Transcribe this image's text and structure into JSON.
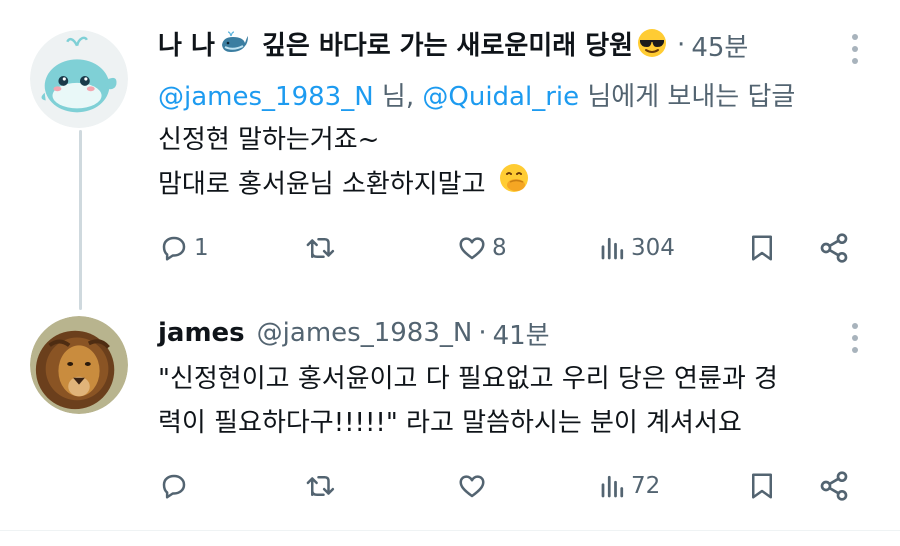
{
  "tweets": [
    {
      "display_name": "나 나🐋 깊은 바다로 가는 새로운미래 당원😎",
      "display_name_parts": {
        "before_whale": "나 나",
        "after_whale": " 깊은 바다로 가는 새로운미래 당원"
      },
      "handle": "",
      "sep": "·",
      "time": "45분",
      "reply_to": {
        "mention1": "@james_1983_N",
        "suffix1": " 님, ",
        "mention2": "@Quidal_rie",
        "suffix2": " 님에게 보내는 답글"
      },
      "text_lines": [
        "신정현 말하는거죠~",
        "맘대로 홍서윤님 소환하지말고 🤭"
      ],
      "text_line2_main": "맘대로 홍서윤님 소환하지말고",
      "counts": {
        "reply": "1",
        "retweet": "",
        "like": "8",
        "views": "304"
      },
      "avatar_icon": "whale-avatar",
      "accent_color": "#1d9bf0"
    },
    {
      "display_name": "james",
      "handle": "@james_1983_N",
      "sep": "·",
      "time": "41분",
      "text_lines": [
        "\"신정현이고 홍서윤이고 다 필요없고 우리 당은 연륜과 경",
        "력이 필요하다구!!!!!\" 라고 말씀하시는 분이 계셔서요"
      ],
      "counts": {
        "reply": "",
        "retweet": "",
        "like": "",
        "views": "72"
      },
      "avatar_icon": "lion-avatar"
    }
  ]
}
